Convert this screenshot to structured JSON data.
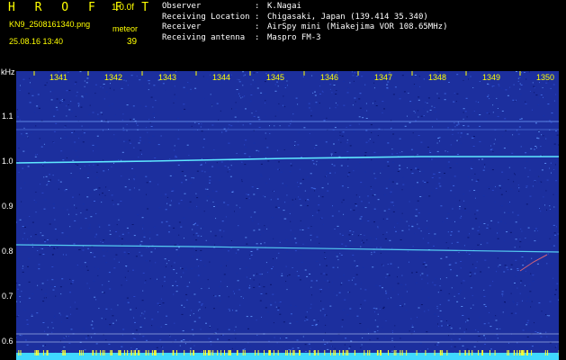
{
  "header": {
    "brand": "H R O F F T",
    "version": "1.0.0f",
    "filename": "KN9_2508161340.png",
    "datetime": "25.08.16 13:40",
    "mode": "meteor",
    "count": "39"
  },
  "info": [
    {
      "label": "Observer",
      "value": "K.Nagai"
    },
    {
      "label": "Receiving Location",
      "value": "Chigasaki, Japan (139.414 35.340)"
    },
    {
      "label": "Receiver",
      "value": "AirSpy mini (Miakejima VOR 108.65MHz)"
    },
    {
      "label": "Receiving antenna",
      "value": "Maspro FM-3"
    }
  ],
  "axis": {
    "unit": "kHz",
    "y_ticks": [
      "1.1",
      "1.0",
      "0.9",
      "0.8",
      "0.7",
      "0.6"
    ],
    "x_ticks": [
      "1341",
      "1342",
      "1343",
      "1344",
      "1345",
      "1346",
      "1347",
      "1348",
      "1349",
      "1350"
    ]
  },
  "colors": {
    "header_text": "#ffff00",
    "background": "#1c2f9e",
    "trace": "#5fe8ff",
    "bottom_bar": "#3fd9ff"
  }
}
